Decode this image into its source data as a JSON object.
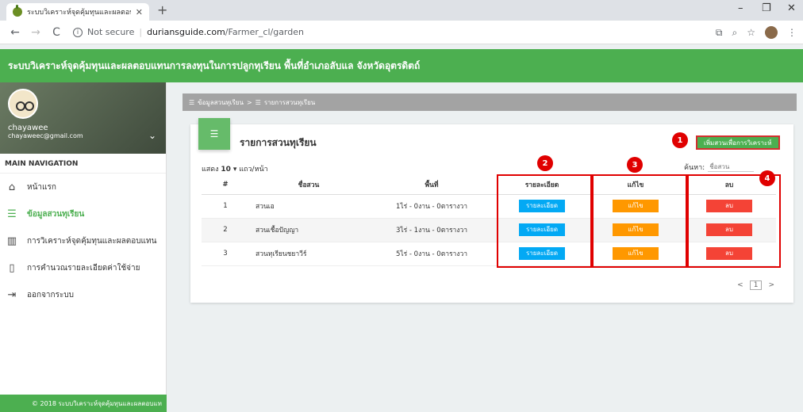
{
  "browser": {
    "tab_title": "ระบบวิเคราะห์จุดคุ้มทุนและผลตอบแทน",
    "tab_close": "✕",
    "new_tab": "+",
    "url_prefix": "Not secure",
    "url_domain": "duriansguide.com",
    "url_path": "/Farmer_cl/garden"
  },
  "header": {
    "title": "ระบบวิเคราะห์จุดคุ้มทุนและผลตอบแทนการลงทุนในการปลูกทุเรียน พื้นที่อำเภอลับแล จังหวัดอุตรดิตถ์"
  },
  "user": {
    "name": "chayawee",
    "email": "chayaweec@gmail.com"
  },
  "sidebar": {
    "nav_header": "MAIN NAVIGATION",
    "items": [
      {
        "label": "หน้าแรก",
        "icon": "home-icon"
      },
      {
        "label": "ข้อมูลสวนทุเรียน",
        "icon": "list-icon"
      },
      {
        "label": "การวิเคราะห์จุดคุ้มทุนและผลตอบแทน",
        "icon": "chart-icon"
      },
      {
        "label": "การคำนวณรายละเอียดค่าใช้จ่าย",
        "icon": "clipboard-icon"
      },
      {
        "label": "ออกจากระบบ",
        "icon": "logout-icon"
      }
    ],
    "footer": "© 2018 ระบบวิเคราะห์จุดคุ้มทุนและผลตอบแท"
  },
  "breadcrumb": {
    "item1": "ข้อมูลสวนทุเรียน",
    "sep": ">",
    "item2": "รายการสวนทุเรียน"
  },
  "card": {
    "title": "รายการสวนทุเรียน",
    "add_button": "เพิ่มสวนเพื่อการวิเคราะห์",
    "page_size_label": "แสดง",
    "page_size_value": "10",
    "page_size_suffix": "แถว/หน้า",
    "search_label": "ค้นหา:",
    "search_placeholder": "ชื่อสวน"
  },
  "table": {
    "headers": [
      "#",
      "ชื่อสวน",
      "พื้นที่",
      "รายละเอียด",
      "แก้ไข",
      "ลบ"
    ],
    "rows": [
      {
        "no": "1",
        "name": "สวนเอ",
        "area": "1ไร่ - 0งาน - 0ตารางวา"
      },
      {
        "no": "2",
        "name": "สวนเชื้อปัญญา",
        "area": "3ไร่ - 1งาน - 0ตารางวา"
      },
      {
        "no": "3",
        "name": "สวนทุเรียนชยาวีร์",
        "area": "5ไร่ - 0งาน - 0ตารางวา"
      }
    ],
    "detail_label": "รายละเอียด",
    "edit_label": "แก้ไข",
    "delete_label": "ลบ"
  },
  "pager": {
    "prev": "<",
    "current": "1",
    "next": ">"
  },
  "annotations": [
    "1",
    "2",
    "3",
    "4"
  ],
  "colors": {
    "primary": "#4caf50",
    "info": "#03a9f4",
    "warning": "#ff9800",
    "danger": "#f44336",
    "annotation": "#e00000"
  }
}
